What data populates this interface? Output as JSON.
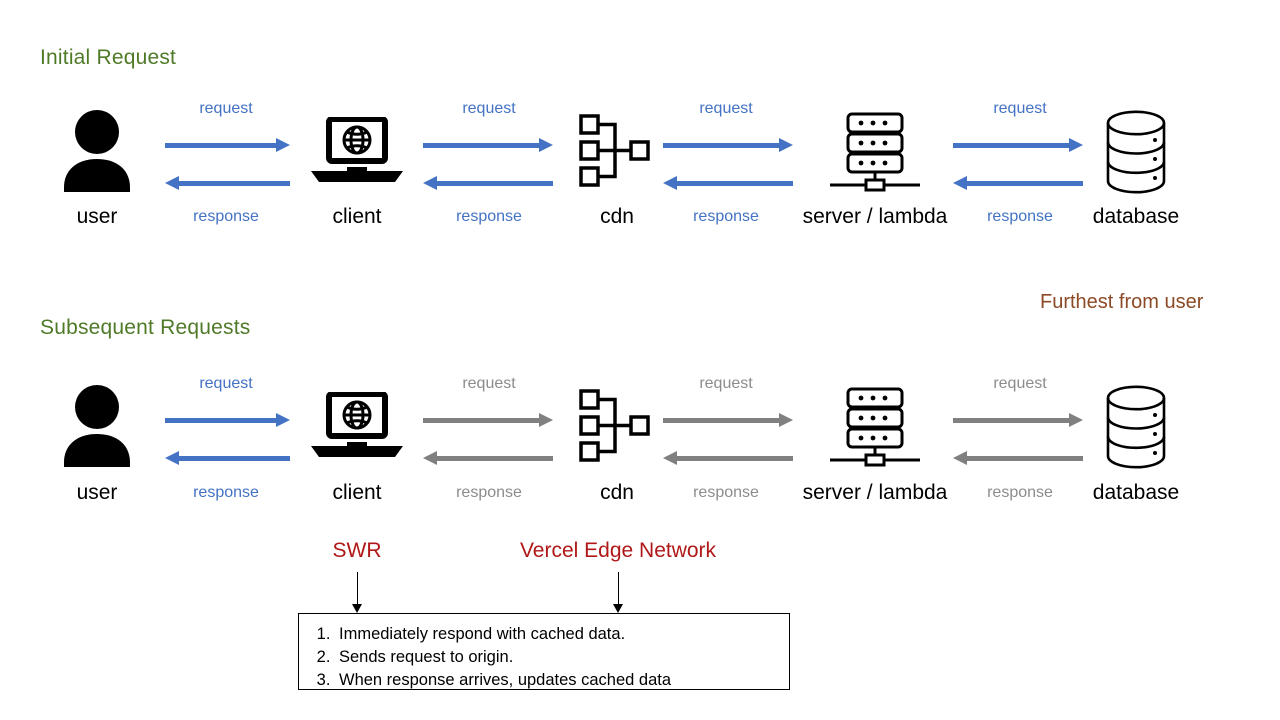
{
  "sections": [
    {
      "title": "Initial Request"
    },
    {
      "title": "Subsequent Requests"
    }
  ],
  "annotations": {
    "furthest_from_user": "Furthest from user"
  },
  "nodes": [
    {
      "key": "user",
      "label": "user",
      "icon": "user-icon"
    },
    {
      "key": "client",
      "label": "client",
      "icon": "laptop-globe-icon"
    },
    {
      "key": "cdn",
      "label": "cdn",
      "icon": "network-topology-icon"
    },
    {
      "key": "server",
      "label": "server / lambda",
      "icon": "server-rack-icon"
    },
    {
      "key": "database",
      "label": "database",
      "icon": "database-cylinder-icon"
    }
  ],
  "arrow_labels": {
    "request": "request",
    "response": "response"
  },
  "row1_links": [
    {
      "from": "user",
      "to": "client",
      "request_color": "#4472c4",
      "response_color": "#4472c4"
    },
    {
      "from": "client",
      "to": "cdn",
      "request_color": "#4472c4",
      "response_color": "#4472c4"
    },
    {
      "from": "cdn",
      "to": "server",
      "request_color": "#4472c4",
      "response_color": "#4472c4"
    },
    {
      "from": "server",
      "to": "database",
      "request_color": "#4472c4",
      "response_color": "#4472c4"
    }
  ],
  "row2_links": [
    {
      "from": "user",
      "to": "client",
      "request_color": "#4472c4",
      "response_color": "#4472c4"
    },
    {
      "from": "client",
      "to": "cdn",
      "request_color": "#808080",
      "response_color": "#808080"
    },
    {
      "from": "cdn",
      "to": "server",
      "request_color": "#808080",
      "response_color": "#808080"
    },
    {
      "from": "server",
      "to": "database",
      "request_color": "#808080",
      "response_color": "#808080"
    }
  ],
  "callouts": [
    {
      "key": "swr",
      "label": "SWR"
    },
    {
      "key": "vercel",
      "label": "Vercel Edge Network"
    }
  ],
  "steps": [
    "Immediately respond with cached data.",
    "Sends request to origin.",
    "When response arrives, updates cached data"
  ],
  "colors": {
    "section_heading": "#4f7a28",
    "active_arrow": "#4472c4",
    "inactive_arrow": "#808080",
    "callout": "#b01818",
    "note": "#8c4a26",
    "icon": "#000000"
  }
}
